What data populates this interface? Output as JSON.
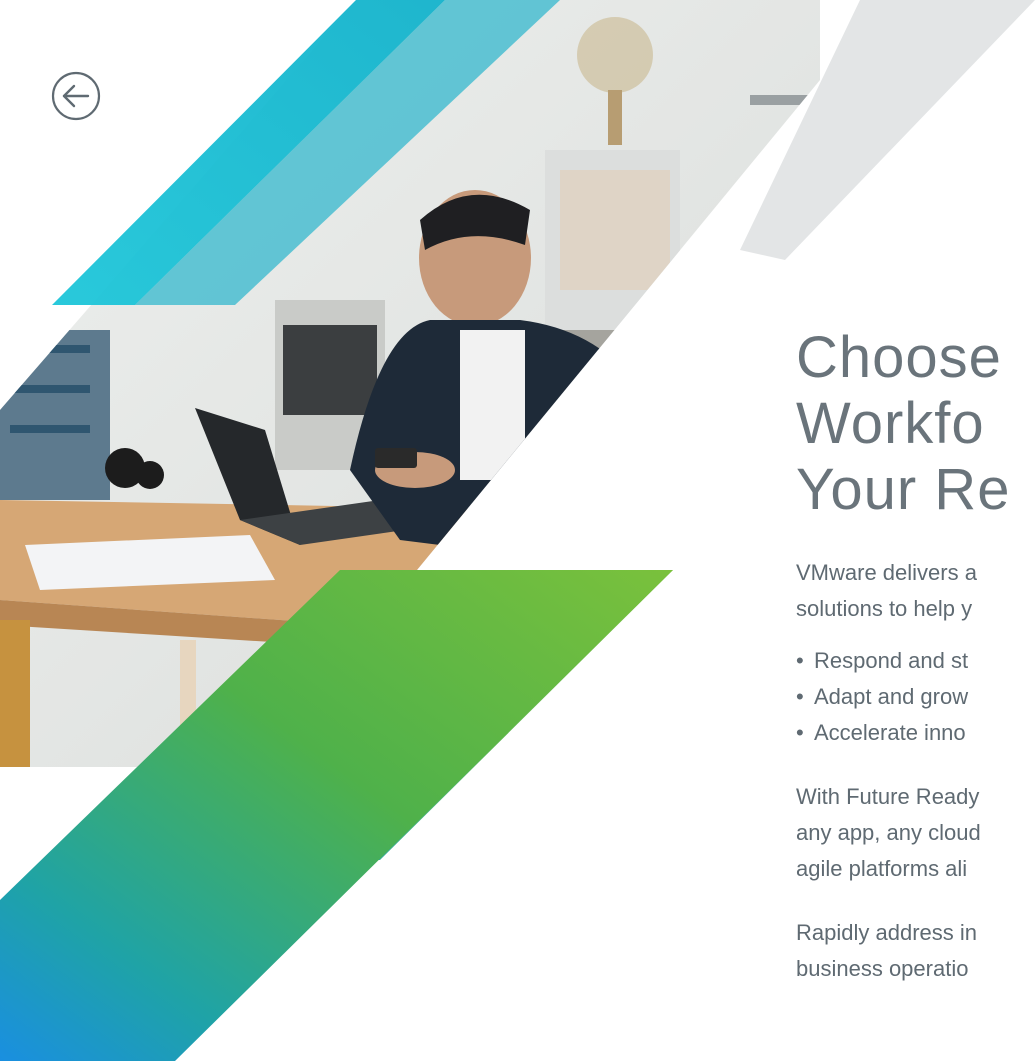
{
  "page": {
    "back_icon": "arrow-left-circle-icon",
    "headline_lines": [
      "Choose",
      "Workfo",
      "Your Re"
    ],
    "intro_lines": [
      "VMware delivers a",
      "solutions to help y"
    ],
    "bullets": [
      "Respond and st",
      "Adapt and grow",
      "Accelerate inno"
    ],
    "para1_lines": [
      "With Future Ready",
      "any app, any cloud",
      "agile platforms ali"
    ],
    "para2_lines": [
      "Rapidly address in",
      "business operatio"
    ],
    "colors": {
      "cyan": "#1ec6d9",
      "green": "#7abf3c",
      "blue": "#1f8fd9",
      "text": "#5f6a72"
    }
  }
}
